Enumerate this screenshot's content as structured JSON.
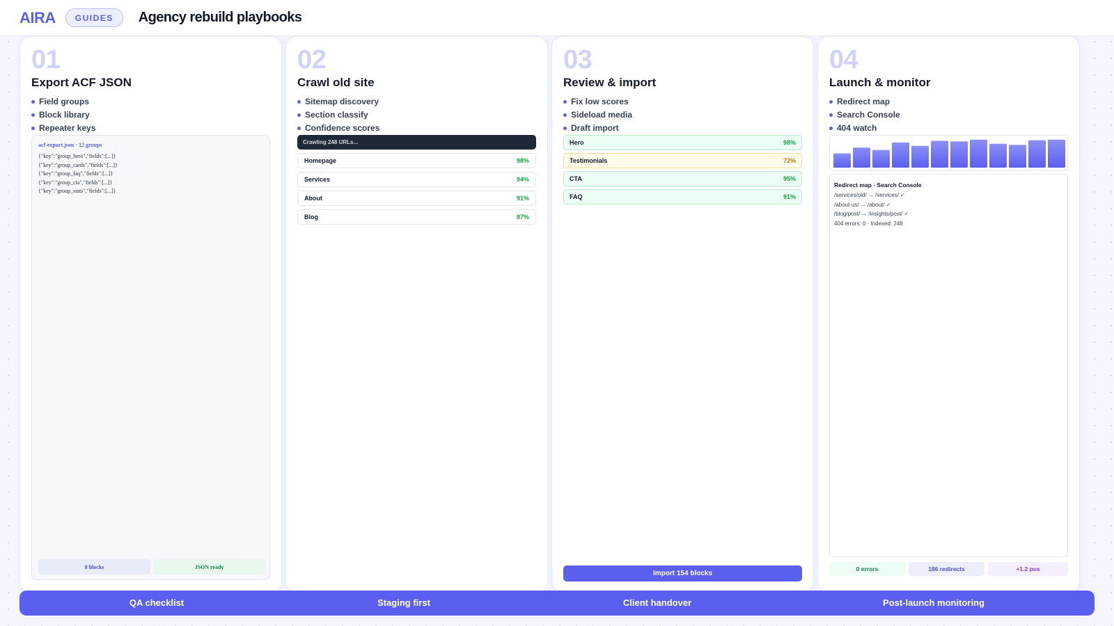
{
  "header": {
    "logo": "AIRA",
    "badge": "GUIDES",
    "title": "Agency rebuild playbooks"
  },
  "colors": {
    "accent": "#5b5ff0",
    "dark": "#1f2937",
    "success": "#16a34a",
    "warning": "#c27c0e"
  },
  "cards": [
    {
      "num": "01",
      "title": "Export ACF JSON",
      "bullets": [
        "Field groups",
        "Block library",
        "Repeater keys"
      ],
      "file_label": "acf-export.json · 12 groups",
      "code_lines": [
        "{\"key\":\"group_hero\",\"fields\":[...]}",
        "{\"key\":\"group_cards\",\"fields\":[...]}",
        "{\"key\":\"group_faq\",\"fields\":[...]}",
        "{\"key\":\"group_cta\",\"fields\":[...]}",
        "{\"key\":\"group_stats\",\"fields\":[...]}"
      ],
      "foot_blocks": "8 blocks",
      "foot_status": "JSON ready"
    },
    {
      "num": "02",
      "title": "Crawl old site",
      "bullets": [
        "Sitemap discovery",
        "Section classify",
        "Confidence scores"
      ],
      "progress_label": "Crawling 248 URLs...",
      "rows": [
        {
          "label": "Homepage",
          "pct": "98%"
        },
        {
          "label": "Services",
          "pct": "94%"
        },
        {
          "label": "About",
          "pct": "91%"
        },
        {
          "label": "Blog",
          "pct": "87%"
        }
      ]
    },
    {
      "num": "03",
      "title": "Review & import",
      "bullets": [
        "Fix low scores",
        "Sideload media",
        "Draft import"
      ],
      "rows": [
        {
          "label": "Hero",
          "pct": "98%",
          "status": "ok"
        },
        {
          "label": "Testimonials",
          "pct": "72%",
          "status": "warn"
        },
        {
          "label": "CTA",
          "pct": "95%",
          "status": "ok"
        },
        {
          "label": "FAQ",
          "pct": "91%",
          "status": "ok"
        }
      ],
      "button": "Import 154 blocks"
    },
    {
      "num": "04",
      "title": "Launch & monitor",
      "bullets": [
        "Redirect map",
        "Search Console",
        "404 watch"
      ],
      "panel_title": "Redirect map · Search Console",
      "panel_lines": [
        "/services/old/ → /services/ ✓",
        "/about-us/ → /about/ ✓",
        "/blog/post/ → /insights/post/ ✓",
        "404 errors: 0 · Indexed: 248"
      ],
      "stats": [
        "0 errors",
        "186 redirects",
        "+1.2 pos"
      ]
    }
  ],
  "chart_data": {
    "type": "bar",
    "categories": [],
    "values": [
      0.5,
      0.7,
      0.62,
      0.88,
      0.76,
      0.94,
      0.92,
      0.98,
      0.84,
      0.8,
      0.96,
      0.98
    ],
    "ylim": [
      0,
      1
    ],
    "grid": false,
    "colors": [
      "#8b8ff7",
      "#5b5ff0"
    ]
  },
  "footer": [
    "QA checklist",
    "Staging first",
    "Client handover",
    "Post-launch monitoring"
  ]
}
